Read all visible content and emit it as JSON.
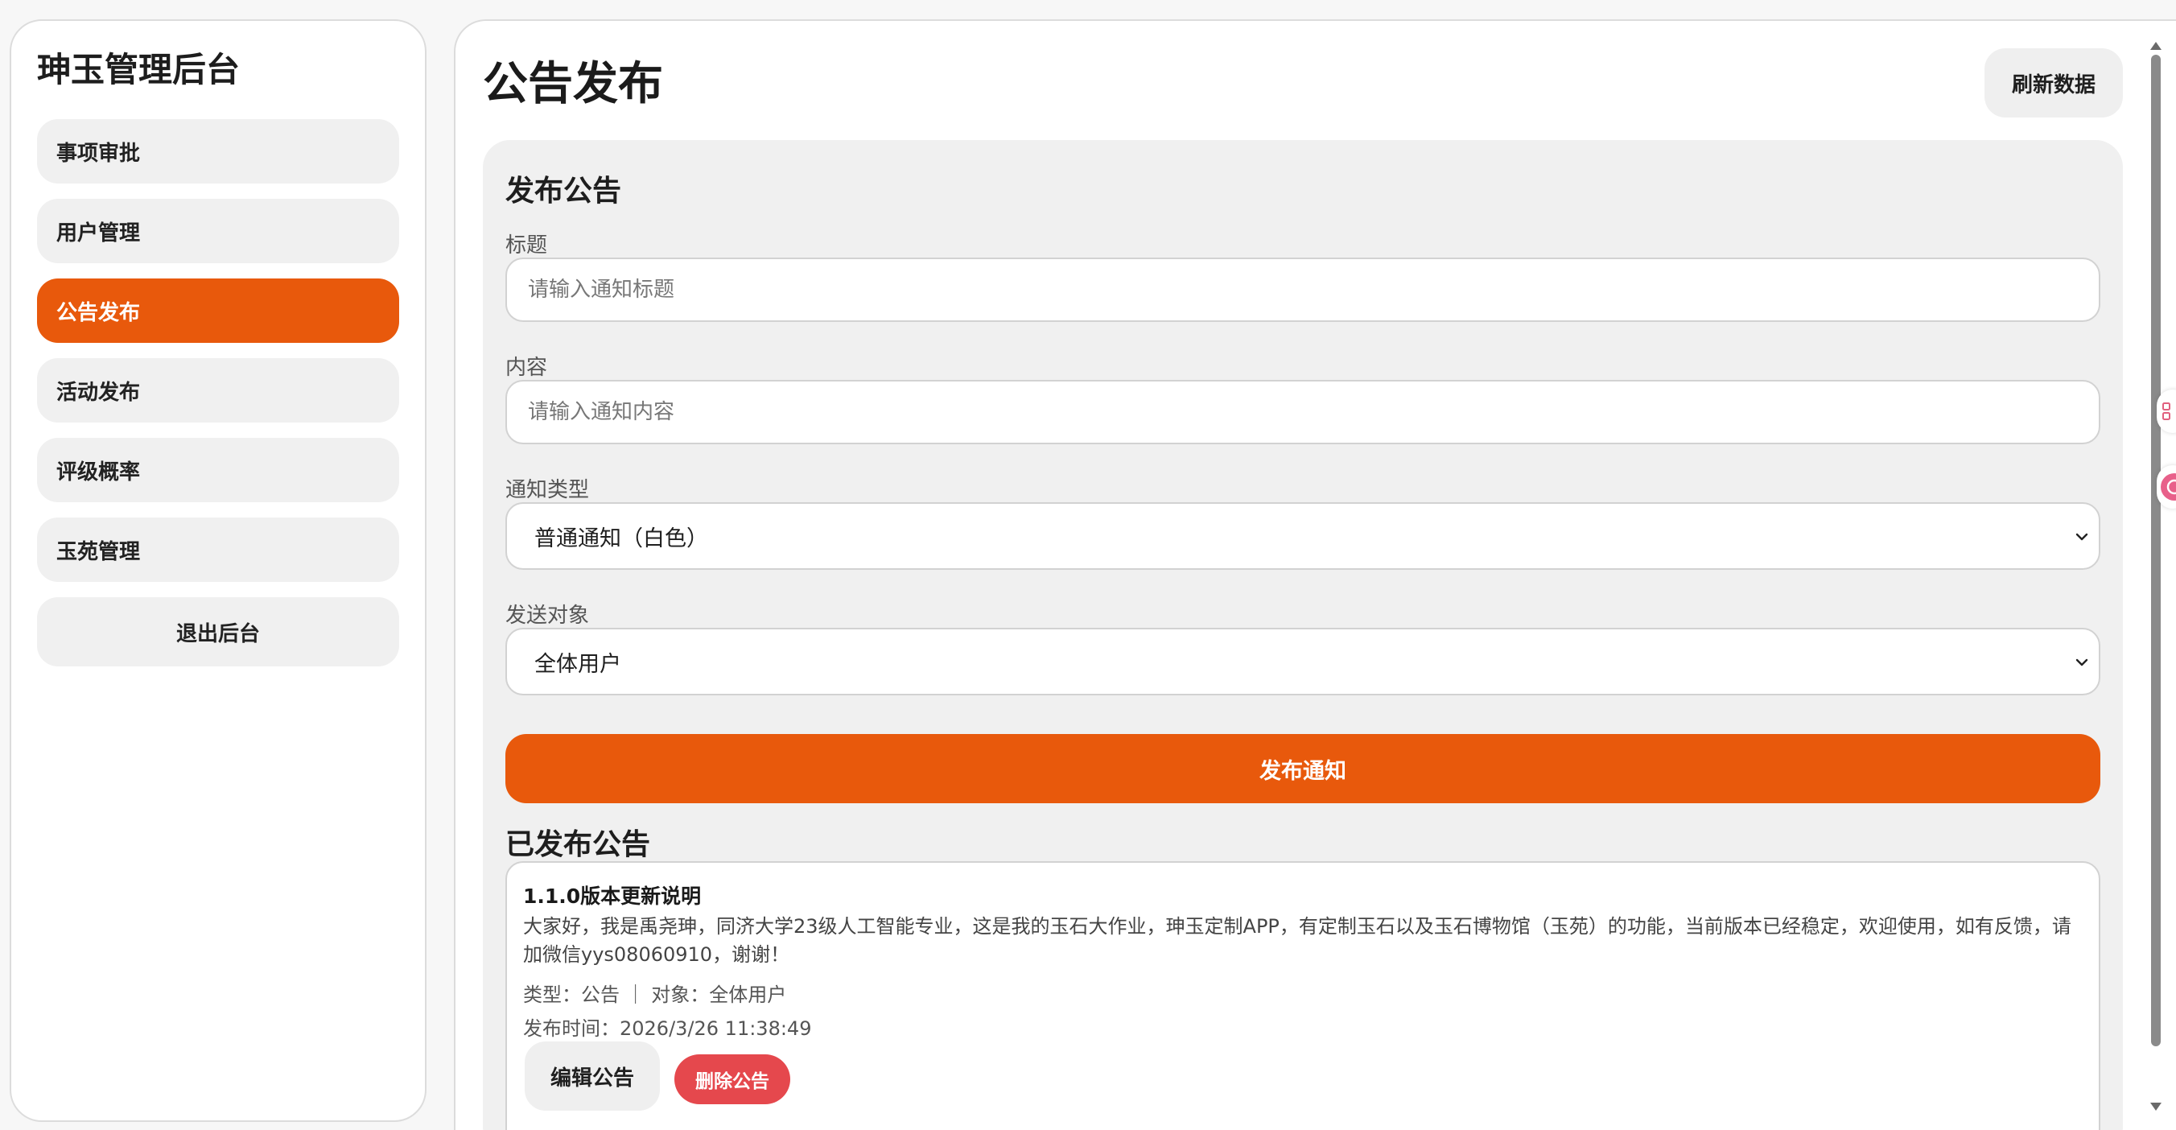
{
  "sidebar": {
    "brand": "珅玉管理后台",
    "items": [
      {
        "label": "事项审批",
        "active": false
      },
      {
        "label": "用户管理",
        "active": false
      },
      {
        "label": "公告发布",
        "active": true
      },
      {
        "label": "活动发布",
        "active": false
      },
      {
        "label": "评级概率",
        "active": false
      },
      {
        "label": "玉苑管理",
        "active": false
      }
    ],
    "logout_label": "退出后台"
  },
  "header": {
    "title": "公告发布",
    "refresh_label": "刷新数据"
  },
  "form": {
    "section_title": "发布公告",
    "title_label": "标题",
    "title_placeholder": "请输入通知标题",
    "content_label": "内容",
    "content_placeholder": "请输入通知内容",
    "type_label": "通知类型",
    "type_value": "普通通知（白色）",
    "target_label": "发送对象",
    "target_value": "全体用户",
    "submit_label": "发布通知"
  },
  "published": {
    "section_title": "已发布公告",
    "notices": [
      {
        "title": "1.1.0版本更新说明",
        "body": "大家好，我是禹尧珅，同济大学23级人工智能专业，这是我的玉石大作业，珅玉定制APP，有定制玉石以及玉石博物馆（玉苑）的功能，当前版本已经稳定，欢迎使用，如有反馈，请加微信yys08060910，谢谢！",
        "meta": "类型：公告 ｜ 对象：全体用户",
        "time": "发布时间：2026/3/26 11:38:49",
        "edit_label": "编辑公告",
        "delete_label": "删除公告"
      }
    ]
  },
  "colors": {
    "accent": "#e8590c",
    "danger": "#e5484d",
    "card_bg": "#f0f0f0"
  },
  "icons": {
    "select_chevron": "chevron-down-icon"
  }
}
